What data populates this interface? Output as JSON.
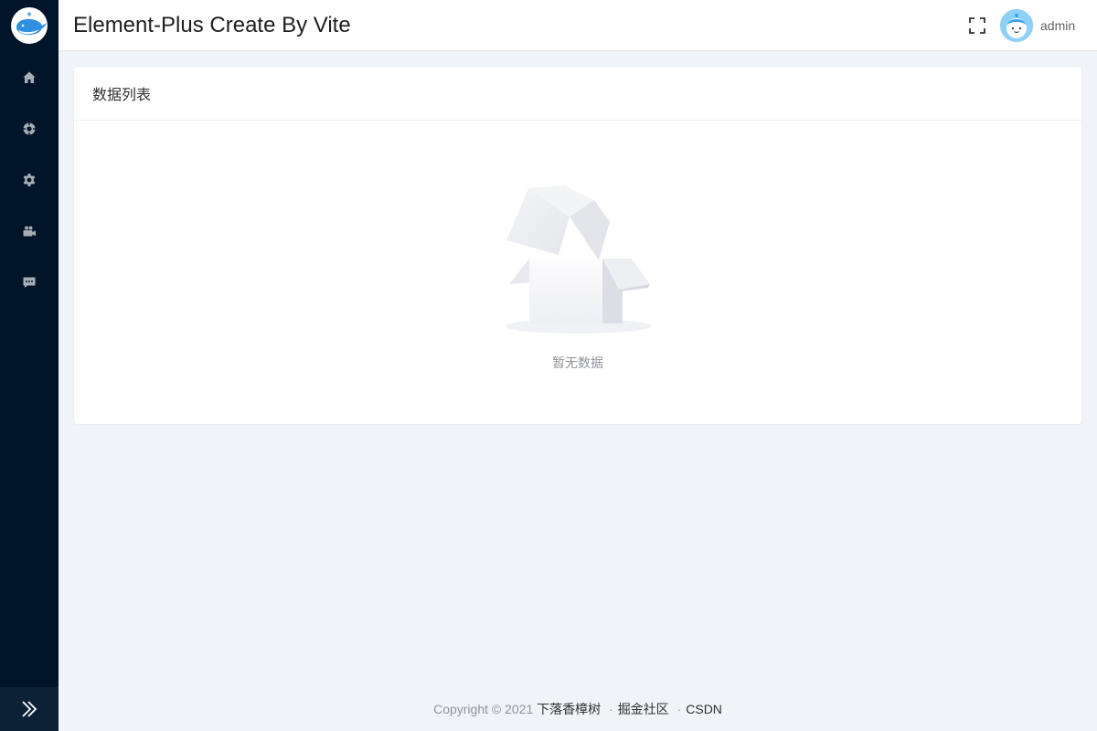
{
  "header": {
    "title": "Element-Plus Create By Vite",
    "username": "admin"
  },
  "sidebar": {
    "items": [
      {
        "name": "home",
        "icon": "home-icon"
      },
      {
        "name": "compass",
        "icon": "compass-icon"
      },
      {
        "name": "settings",
        "icon": "gear-icon"
      },
      {
        "name": "camera",
        "icon": "video-camera-icon"
      },
      {
        "name": "messages",
        "icon": "chat-icon"
      }
    ],
    "collapse_icon": "double-chevron-right-icon"
  },
  "card": {
    "title": "数据列表",
    "empty_text": "暂无数据"
  },
  "footer": {
    "copyright": "Copyright © 2021",
    "links": [
      "下落香樟树",
      "掘金社区",
      "CSDN"
    ],
    "separator": "·"
  },
  "colors": {
    "sidebar_bg": "#001529",
    "page_bg": "#f0f3f7",
    "header_bg": "#ffffff"
  }
}
